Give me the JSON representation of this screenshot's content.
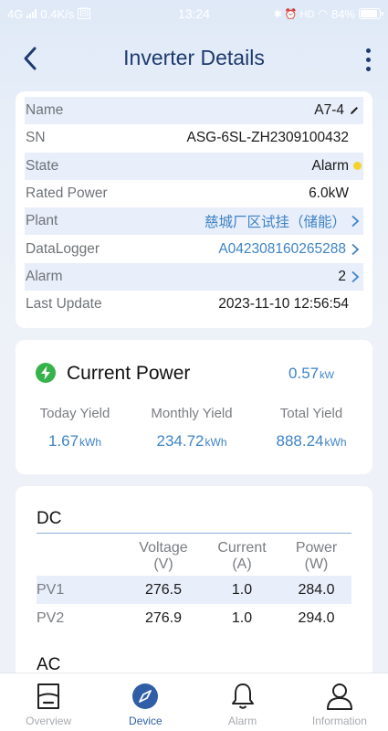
{
  "status_bar": {
    "network": "4G",
    "speed": "0.4K/s",
    "time": "13:24",
    "icons_right": "✱ ⏰ HD",
    "battery": "84%"
  },
  "header": {
    "title": "Inverter Details"
  },
  "info": {
    "rows": [
      {
        "label": "Name",
        "value": "A7-4"
      },
      {
        "label": "SN",
        "value": "ASG-6SL-ZH2309100432"
      },
      {
        "label": "State",
        "value": "Alarm"
      },
      {
        "label": "Rated Power",
        "value": "6.0kW"
      },
      {
        "label": "Plant",
        "value": "慈城厂区试挂（储能）"
      },
      {
        "label": "DataLogger",
        "value": "A042308160265288"
      },
      {
        "label": "Alarm",
        "value": "2"
      },
      {
        "label": "Last Update",
        "value": "2023-11-10 12:56:54"
      }
    ],
    "state_color": "#f4d32c"
  },
  "current_power": {
    "title": "Current Power",
    "value": "0.57",
    "unit": "kW",
    "yields": [
      {
        "label": "Today Yield",
        "value": "1.67",
        "unit": "kWh"
      },
      {
        "label": "Monthly Yield",
        "value": "234.72",
        "unit": "kWh"
      },
      {
        "label": "Total Yield",
        "value": "888.24",
        "unit": "kWh"
      }
    ]
  },
  "dc": {
    "title": "DC",
    "headers": [
      {
        "name": "Voltage",
        "unit": "(V)"
      },
      {
        "name": "Current",
        "unit": "(A)"
      },
      {
        "name": "Power",
        "unit": "(W)"
      }
    ],
    "rows": [
      {
        "label": "PV1",
        "voltage": "276.5",
        "current": "1.0",
        "power": "284.0"
      },
      {
        "label": "PV2",
        "voltage": "276.9",
        "current": "1.0",
        "power": "294.0"
      }
    ]
  },
  "ac": {
    "title": "AC"
  },
  "nav": {
    "items": [
      {
        "label": "Overview",
        "icon": "overview-icon"
      },
      {
        "label": "Device",
        "icon": "device-compass-icon"
      },
      {
        "label": "Alarm",
        "icon": "bell-icon"
      },
      {
        "label": "Information",
        "icon": "person-icon"
      }
    ],
    "active": "Device"
  },
  "colors": {
    "accent": "#3e83c5",
    "title": "#1e3a6e",
    "active_nav": "#2f5ea6",
    "ok_green": "#36b24a"
  }
}
